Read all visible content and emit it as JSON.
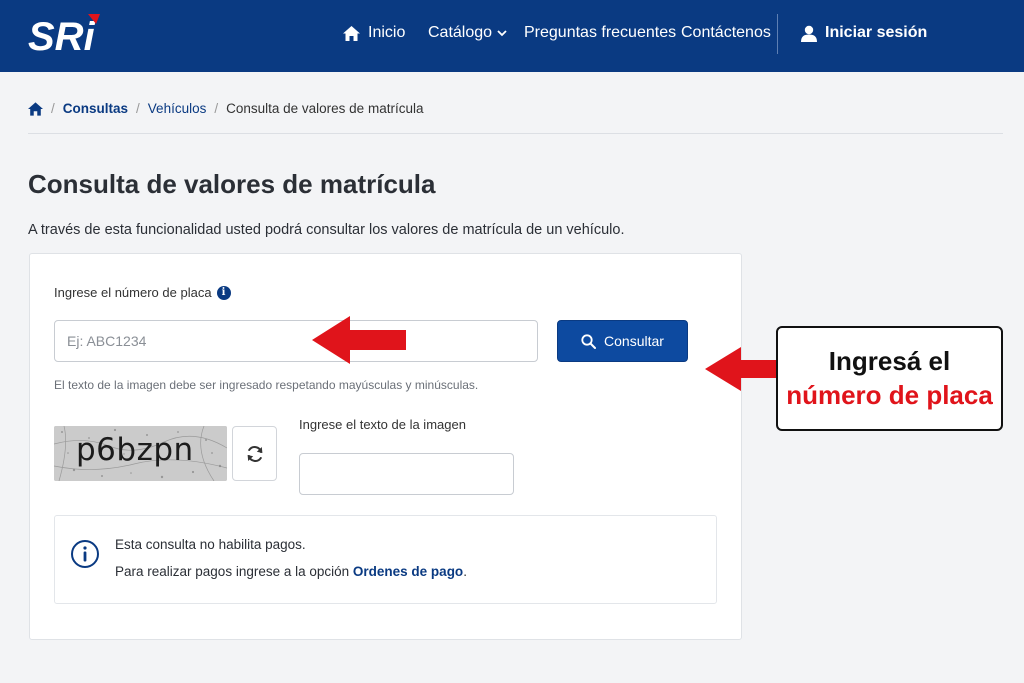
{
  "colors": {
    "header_bg": "#0a3a82",
    "primary_button": "#0d4aa0",
    "link": "#0a3a82",
    "annotation_red": "#e0141b"
  },
  "header": {
    "logo_text": "SRi",
    "nav": {
      "home": "Inicio",
      "catalog": "Catálogo",
      "faq": "Preguntas frecuentes",
      "contact": "Contáctenos",
      "login": "Iniciar sesión"
    }
  },
  "breadcrumb": {
    "items": [
      "Consultas",
      "Vehículos",
      "Consulta de valores de matrícula"
    ]
  },
  "page": {
    "title": "Consulta de valores de matrícula",
    "description": "A través de esta funcionalidad usted podrá consultar los valores de matrícula de un vehículo."
  },
  "form": {
    "plate_label": "Ingrese el número de placa",
    "plate_placeholder": "Ej: ABC1234",
    "plate_value": "",
    "submit_label": "Consultar",
    "case_hint": "El texto de la imagen debe ser ingresado respetando mayúsculas y minúsculas.",
    "captcha_text": "p6bzpn",
    "captcha_label": "Ingrese el texto de la imagen",
    "captcha_value": ""
  },
  "notice": {
    "line1": "Esta consulta no habilita pagos.",
    "line2_prefix": "Para realizar pagos ingrese a la opción ",
    "line2_link": "Ordenes de pago",
    "line2_suffix": "."
  },
  "annotation": {
    "line1": "Ingresá el",
    "line2": "número de placa"
  }
}
